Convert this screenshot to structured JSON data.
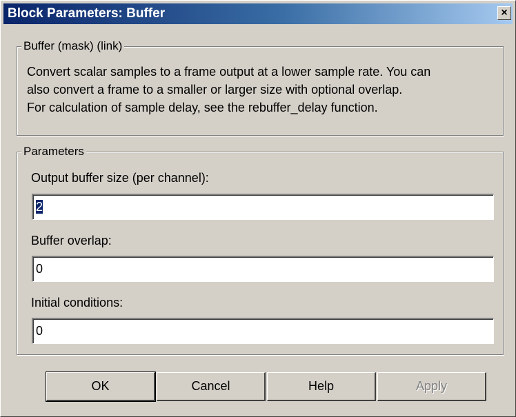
{
  "window": {
    "title": "Block Parameters: Buffer",
    "close_glyph": "✕"
  },
  "mask_group": {
    "label": "Buffer (mask) (link)",
    "description_lines": [
      "Convert scalar samples to a frame output at a lower sample rate.  You can",
      "also convert a frame to a smaller or larger size with optional overlap.",
      "For calculation of sample delay, see the rebuffer_delay function."
    ]
  },
  "parameters": {
    "label": "Parameters",
    "fields": [
      {
        "label": "Output buffer size (per channel):",
        "value": "2",
        "selected": true
      },
      {
        "label": "Buffer overlap:",
        "value": "0",
        "selected": false
      },
      {
        "label": "Initial conditions:",
        "value": "0",
        "selected": false
      }
    ]
  },
  "buttons": {
    "ok": "OK",
    "cancel": "Cancel",
    "help": "Help",
    "apply": "Apply"
  },
  "colors": {
    "title_bar": "#0a246a",
    "dialog_face": "#d4d0c8",
    "selection": "#0a246a"
  }
}
